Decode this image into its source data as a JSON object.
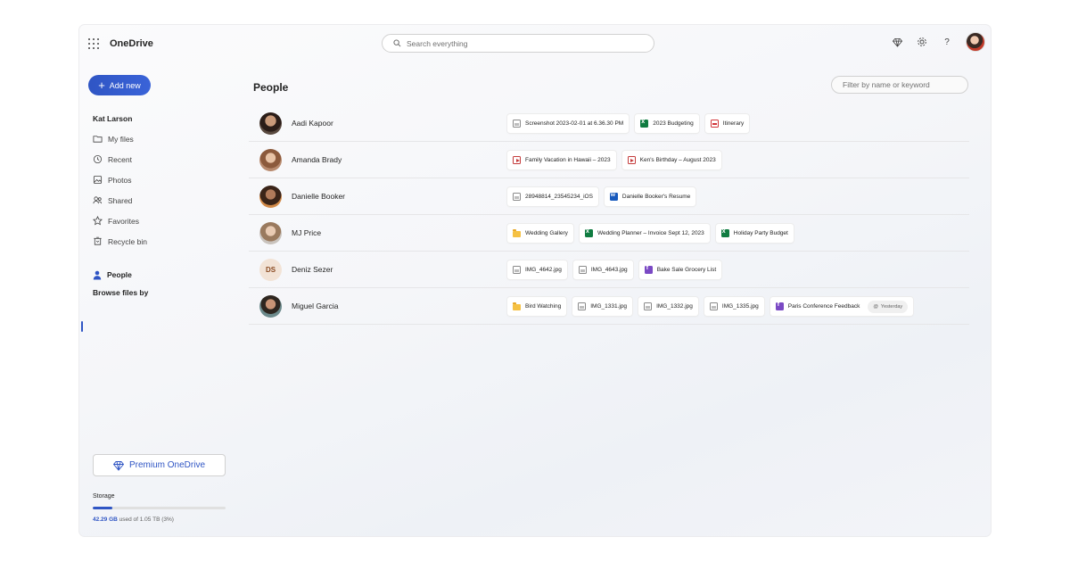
{
  "header": {
    "app_title": "OneDrive",
    "search_placeholder": "Search everything"
  },
  "sidebar": {
    "add_new_label": "Add new",
    "user_name": "Kat Larson",
    "nav_items": [
      {
        "label": "My files",
        "icon": "folder-icon"
      },
      {
        "label": "Recent",
        "icon": "recent-icon"
      },
      {
        "label": "Photos",
        "icon": "photos-icon"
      },
      {
        "label": "Shared",
        "icon": "shared-icon"
      },
      {
        "label": "Favorites",
        "icon": "star-icon"
      },
      {
        "label": "Recycle bin",
        "icon": "recycle-bin-icon"
      }
    ],
    "browse_title": "Browse files by",
    "people_label": "People",
    "premium_label": "Premium OneDrive",
    "storage_label": "Storage",
    "storage_used": "42.29 GB",
    "storage_rest": " used of 1.05 TB (3%)",
    "storage_fraction": 0.15
  },
  "main": {
    "title": "People",
    "filter_placeholder": "Filter by name or keyword",
    "people": [
      {
        "name": "Aadi Kapoor",
        "avatar": "photo",
        "files": [
          {
            "name": "Screenshot 2023-02-01 at 6.36.30 PM",
            "type": "image"
          },
          {
            "name": "2023 Budgeting",
            "type": "excel"
          },
          {
            "name": "Itinerary",
            "type": "pdf"
          }
        ]
      },
      {
        "name": "Amanda Brady",
        "avatar": "photo",
        "files": [
          {
            "name": "Family Vacation in Hawaii – 2023",
            "type": "video"
          },
          {
            "name": "Ken's Birthday – August 2023",
            "type": "video"
          }
        ]
      },
      {
        "name": "Danielle Booker",
        "avatar": "photo",
        "files": [
          {
            "name": "28948814_23545234_iOS",
            "type": "image"
          },
          {
            "name": "Danielle Booker's Resume",
            "type": "word"
          }
        ]
      },
      {
        "name": "MJ Price",
        "avatar": "photo",
        "files": [
          {
            "name": "Wedding Gallery",
            "type": "folder"
          },
          {
            "name": "Wedding Planner – Invoice Sept 12, 2023",
            "type": "excel"
          },
          {
            "name": "Holiday Party Budget",
            "type": "excel"
          }
        ]
      },
      {
        "name": "Deniz Sezer",
        "avatar": "initials",
        "initials": "DS",
        "files": [
          {
            "name": "IMG_4642.jpg",
            "type": "image"
          },
          {
            "name": "IMG_4643.jpg",
            "type": "image"
          },
          {
            "name": "Bake Sale Grocery List",
            "type": "form"
          }
        ]
      },
      {
        "name": "Miguel Garcia",
        "avatar": "photo",
        "files": [
          {
            "name": "Bird Watching",
            "type": "folder"
          },
          {
            "name": "IMG_1331.jpg",
            "type": "image"
          },
          {
            "name": "IMG_1332.jpg",
            "type": "image"
          },
          {
            "name": "IMG_1335.jpg",
            "type": "image"
          },
          {
            "name": "Paris Conference Feedback",
            "type": "form",
            "badge": "Yesterday"
          }
        ]
      }
    ]
  }
}
